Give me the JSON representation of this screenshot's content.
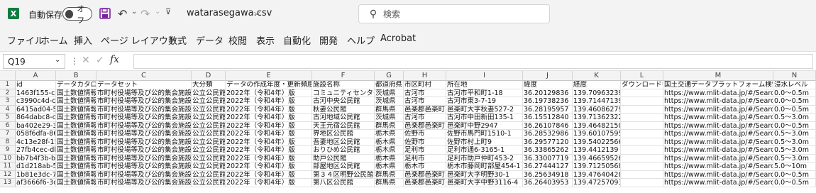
{
  "titlebar": {
    "app_icon": "excel-icon",
    "app_letter": "X",
    "autosave_label": "自動保存",
    "autosave_state": "オフ",
    "save_icon": "save-icon",
    "undo_icon": "undo-icon",
    "redo_icon": "redo-icon",
    "filename": "watarasegawa.csv",
    "search_placeholder": "検索"
  },
  "menu": [
    "ファイル",
    "ホーム",
    "挿入",
    "ページ レイアウト",
    "数式",
    "データ",
    "校閲",
    "表示",
    "自動化",
    "開発",
    "ヘルプ",
    "Acrobat"
  ],
  "formula_bar": {
    "name_box": "Q19",
    "fx_label": "fx",
    "formula": ""
  },
  "grid": {
    "columns": [
      "A",
      "B",
      "C",
      "D",
      "E",
      "F",
      "G",
      "H",
      "I",
      "J",
      "K",
      "L",
      "M",
      "N"
    ],
    "rows": [
      [
        "id",
        "データカタログ",
        "データセット",
        "大分類",
        "データの作成年度・更新頻度",
        "施設名称",
        "都道府県",
        "市区町村",
        "所在地",
        "緯度",
        "経度",
        "ダウンロードURL",
        "国土交通データプラットフォーム検索URL",
        "浸水レベル"
      ],
      [
        "1463f155-c5",
        "国土数値情報",
        "市町村役場等及び公的集会施設",
        "公立公民館",
        "2022年（令和4年）版",
        "コミュニティセンター平和",
        "茨城県",
        "古河市",
        "古河市平和町1-18",
        "36.20129836",
        "139.70963239709903",
        "",
        "https://www.mlit-data.jp/#/Searc",
        "0.0～0.5m"
      ],
      [
        "c3990c4d-cc",
        "国土数値情報",
        "市町村役場等及び公的集会施設",
        "公立公民館",
        "2022年（令和4年）版",
        "古河中央公民館",
        "茨城県",
        "古河市",
        "古河市東3-7-19",
        "36.19738236",
        "139.71447139564438",
        "",
        "https://www.mlit-data.jp/#/Searc",
        "0.0～0.5m"
      ],
      [
        "6415ad04-5c",
        "国土数値情報",
        "市町村役場等及び公的集会施設",
        "公立公民館",
        "2022年（令和4年）版",
        "秋妻公民館",
        "群馬県",
        "邑楽郡邑楽町",
        "邑楽町大字秋妻527-2",
        "36.28195957",
        "139.46086279275536",
        "",
        "https://www.mlit-data.jp/#/Searc",
        "0.0～0.5m"
      ],
      [
        "864dabc8-ct",
        "国土数値情報",
        "市町村役場等及び公的集会施設",
        "公立公民館",
        "2022年（令和4年）版",
        "古河地域公民館",
        "茨城県",
        "古河市",
        "古河市中田新田135-1",
        "36.15512840",
        "139.71362322279821",
        "",
        "https://www.mlit-data.jp/#/Searc",
        "0.5～3.0m"
      ],
      [
        "ba402e29-3",
        "国土数値情報",
        "市町村役場等及び公的集会施設",
        "公立公民館",
        "2022年（令和4年）版",
        "天王元宿公民館",
        "群馬県",
        "邑楽郡邑楽町",
        "邑楽町中野2947",
        "36.26107846",
        "139.46482150564686",
        "",
        "https://www.mlit-data.jp/#/Searc",
        "0.0～0.5m"
      ],
      [
        "058f6dfa-86",
        "国土数値情報",
        "市町村役場等及び公的集会施設",
        "公立公民館",
        "2022年（令和4年）版",
        "界地区公民館",
        "栃木県",
        "佐野市",
        "佐野市馬門町1510-1",
        "36.28532986",
        "139.60107595478968",
        "",
        "https://www.mlit-data.jp/#/Searc",
        "0.5～3.0m"
      ],
      [
        "4c13e28f-15",
        "国土数値情報",
        "市町村役場等及び公的集会施設",
        "公立公民館",
        "2022年（令和4年）版",
        "吾妻地区公民館",
        "栃木県",
        "佐野市",
        "佐野市村上町9",
        "36.29577120",
        "139.54022566335305",
        "",
        "https://www.mlit-data.jp/#/Searc",
        "0.5～3.0m"
      ],
      [
        "27fb4cec-db",
        "国土数値情報",
        "市町村役場等及び公的集会施設",
        "公立公民館",
        "2022年（令和4年）版",
        "おりひめ公民館",
        "栃木県",
        "足利市",
        "足利市通6-3165-1",
        "36.33865262",
        "139.4412139",
        "",
        "https://www.mlit-data.jp/#/Searc",
        "0.5～3.0m"
      ],
      [
        "bb7b4f3b-b7",
        "国土数値情報",
        "市町村役場等及び公的集会施設",
        "公立公民館",
        "2022年（令和4年）版",
        "助戸公民館",
        "栃木県",
        "足利市",
        "足利市助戸仲町453-2",
        "36.33007719",
        "139.46659526063664",
        "",
        "https://www.mlit-data.jp/#/Searc",
        "0.5～3.0m"
      ],
      [
        "d1d218ab-5",
        "国土数値情報",
        "市町村役場等及び公的集会施設",
        "公立公民館",
        "2022年（令和4年）版",
        "部屋地区公民館",
        "栃木県",
        "栃木市",
        "栃木市藤岡町部屋454-1",
        "36.27444127",
        "139.71250568369163",
        "",
        "https://www.mlit-data.jp/#/Searc",
        "5.0～10m"
      ],
      [
        "1b81e3dc-7",
        "国土数値情報",
        "市町村役場等及び公的集会施設",
        "公立公民館",
        "2022年（令和4年）版",
        "第３４区明野公民館",
        "群馬県",
        "邑楽郡邑楽町",
        "邑楽町大字明野30-1",
        "36.25634918",
        "139.47640428663266",
        "",
        "https://www.mlit-data.jp/#/Searc",
        "0.0～0.5m"
      ],
      [
        "af3666f6-3c",
        "国土数値情報",
        "市町村役場等及び公的集会施設",
        "公立公民館",
        "2022年（令和4年）版",
        "第八区公民館",
        "群馬県",
        "邑楽郡邑楽町",
        "邑楽町大字中野3116-4",
        "36.26403953",
        "139.4725709363813",
        "",
        "https://www.mlit-data.jp/#/Searc",
        "0.0～0.5m"
      ]
    ]
  },
  "colors": {
    "excel_green": "#107c41",
    "save_purple": "#7a1fa2",
    "header_bg": "#f3f3f3"
  }
}
